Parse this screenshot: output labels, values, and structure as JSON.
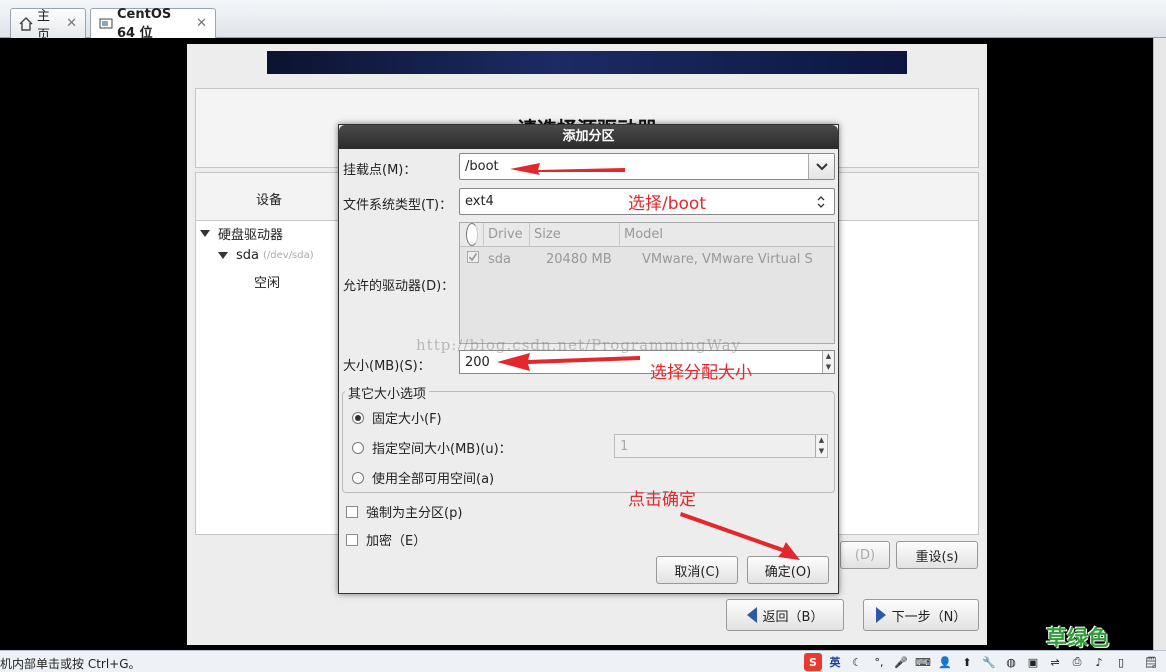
{
  "host": {
    "tabs": [
      {
        "label": "主页"
      },
      {
        "label": "CentOS 64 位"
      }
    ],
    "close_glyph": "✕",
    "status_text": "机内部单击或按 Ctrl+G。",
    "tray_ime": "英"
  },
  "installer": {
    "header_title": "请选择源驱动器",
    "device_column": "设备",
    "tree": {
      "group": "硬盘驱动器",
      "disk": "sda",
      "disk_path": "(/dev/sda)",
      "free": "空闲"
    },
    "hidden_button": "(D)",
    "reset_button": "重设(s)",
    "back_button": "返回（B）",
    "next_button": "下一步（N）"
  },
  "dialog": {
    "title": "添加分区",
    "mount_label": "挂载点(M)：",
    "mount_value": "/boot",
    "fs_label": "文件系统类型(T)：",
    "fs_value": "ext4",
    "drives_label": "允许的驱动器(D)：",
    "drives_columns": [
      "Drive",
      "Size",
      "Model"
    ],
    "drives_rows": [
      {
        "drive": "sda",
        "size": "20480 MB",
        "model": "VMware, VMware Virtual S"
      }
    ],
    "size_label": "大小(MB)(S)：",
    "size_value": "200",
    "other_options_title": "其它大小选项",
    "options": [
      {
        "label": "固定大小(F)",
        "selected": true
      },
      {
        "label": "指定空间大小(MB)(u)：",
        "selected": false
      },
      {
        "label": "使用全部可用空间(a)",
        "selected": false
      }
    ],
    "grow_value": "1",
    "force_primary": "強制为主分区(p)",
    "encrypt": "加密（E）",
    "cancel_button": "取消(C)",
    "ok_button": "确定(O)"
  },
  "annotations": {
    "choose_boot": "选择/boot",
    "choose_size": "选择分配大小",
    "click_ok": "点击确定",
    "watermark": "http://blog.csdn.net/ProgrammingWay",
    "logo": "草绿色",
    "arrow_color": "#e3282d"
  }
}
